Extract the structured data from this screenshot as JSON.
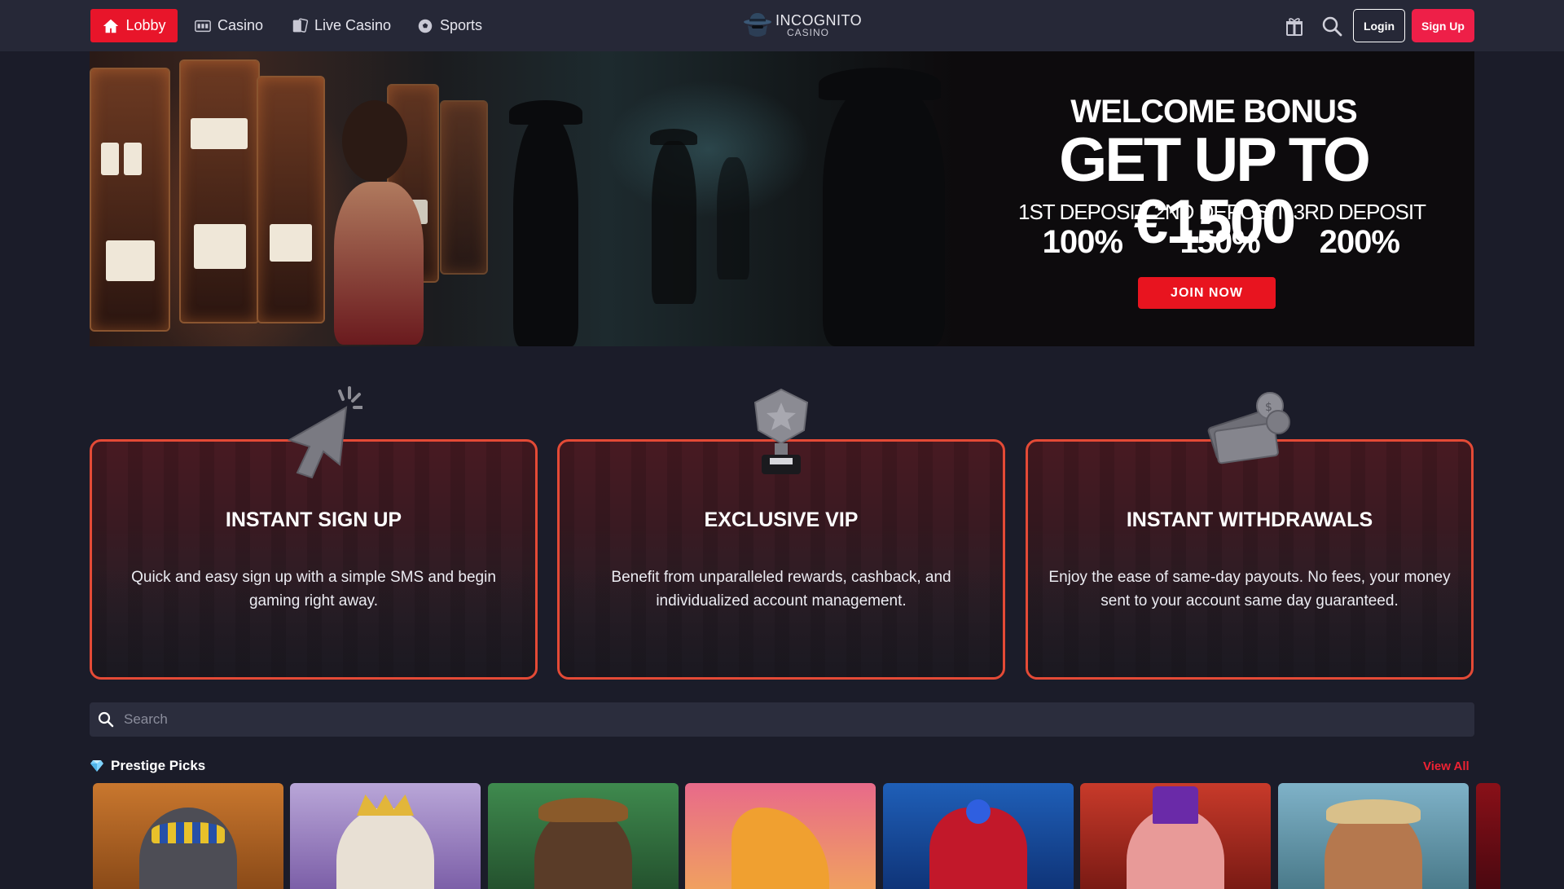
{
  "nav": {
    "items": [
      {
        "label": "Lobby",
        "icon": "home-icon",
        "active": true
      },
      {
        "label": "Casino",
        "icon": "slot-machine-icon"
      },
      {
        "label": "Live Casino",
        "icon": "cards-icon"
      },
      {
        "label": "Sports",
        "icon": "soccer-ball-icon"
      }
    ],
    "logo_main": "INCOGNITO",
    "logo_sub": "CASINO",
    "login_label": "Login",
    "signup_label": "Sign Up"
  },
  "hero": {
    "welcome": "WELCOME BONUS",
    "headline": "GET UP TO €1500",
    "deposits": [
      {
        "label": "1ST DEPOSIT",
        "pct": "100%"
      },
      {
        "label": "2ND DEPOSIT",
        "pct": "150%"
      },
      {
        "label": "3RD DEPOSIT",
        "pct": "200%"
      }
    ],
    "cta": "JOIN NOW"
  },
  "features": [
    {
      "title": "INSTANT SIGN UP",
      "text": "Quick and easy sign up with a simple SMS and begin gaming right away.",
      "icon": "cursor-click-icon"
    },
    {
      "title": "EXCLUSIVE VIP",
      "text": "Benefit from unparalleled rewards, cashback, and individualized account management.",
      "icon": "trophy-icon"
    },
    {
      "title": "INSTANT WITHDRAWALS",
      "text": "Enjoy the ease of same-day payouts. No fees, your money sent to your account same day guaranteed.",
      "icon": "money-coins-icon"
    }
  ],
  "search": {
    "placeholder": "Search"
  },
  "section": {
    "title": "Prestige Picks",
    "view_all": "View All",
    "icon": "diamond-icon"
  },
  "colors": {
    "accent": "#e8152a",
    "signup": "#ee1f48",
    "card_border": "#e44a36",
    "bg": "#1b1c29",
    "nav_bg": "#262837"
  }
}
